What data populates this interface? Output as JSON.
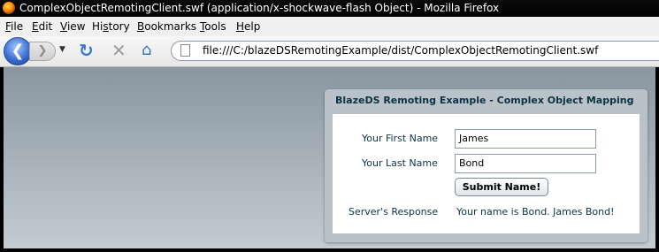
{
  "window": {
    "title": "ComplexObjectRemotingClient.swf (application/x-shockwave-flash Object) - Mozilla Firefox",
    "icon": "firefox-icon"
  },
  "menu": [
    {
      "label": "File",
      "key": "F",
      "rest": "ile"
    },
    {
      "label": "Edit",
      "key": "E",
      "rest": "dit"
    },
    {
      "label": "View",
      "key": "V",
      "rest": "iew"
    },
    {
      "label": "History",
      "key": "s",
      "pre": "Hi",
      "rest": "tory"
    },
    {
      "label": "Bookmarks",
      "key": "B",
      "rest": "ookmarks"
    },
    {
      "label": "Tools",
      "key": "T",
      "rest": "ools"
    },
    {
      "label": "Help",
      "key": "H",
      "rest": "elp"
    }
  ],
  "nav": {
    "back_icon": "back-arrow-icon",
    "forward_icon": "forward-arrow-icon",
    "reload_icon": "reload-icon",
    "stop_icon": "stop-icon",
    "home_icon": "home-icon",
    "url": "file:///C:/blazeDSRemotingExample/dist/ComplexObjectRemotingClient.swf"
  },
  "app": {
    "panel_title": "BlazeDS Remoting Example - Complex Object Mapping",
    "first_name_label": "Your First Name",
    "first_name_value": "James",
    "last_name_label": "Your Last Name",
    "last_name_value": "Bond",
    "submit_label": "Submit Name!",
    "response_label": "Server's Response",
    "response_text": "Your name is Bond. James Bond!"
  }
}
